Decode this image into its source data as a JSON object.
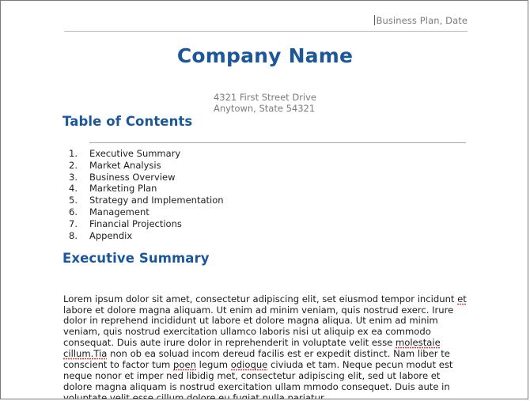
{
  "document": {
    "header": {
      "text": "Business Plan, Date",
      "caret_visible": true
    },
    "title": "Company Name",
    "address": {
      "line1": "4321 First Street Drive",
      "line2": "Anytown, State 54321"
    },
    "toc": {
      "heading": "Table of Contents",
      "items": [
        {
          "number": "1.",
          "label": "Executive Summary"
        },
        {
          "number": "2.",
          "label": "Market Analysis"
        },
        {
          "number": "3.",
          "label": "Business Overview"
        },
        {
          "number": "4.",
          "label": "Marketing Plan"
        },
        {
          "number": "5.",
          "label": "Strategy and Implementation"
        },
        {
          "number": "6.",
          "label": "Management"
        },
        {
          "number": "7.",
          "label": "Financial Projections"
        },
        {
          "number": "8.",
          "label": "Appendix"
        }
      ]
    },
    "executive_summary": {
      "heading": "Executive Summary",
      "segments": [
        {
          "text": "Lorem ipsum dolor sit amet, consectetur adipiscing elit, set eiusmod tempor incidunt ",
          "misspelled": false
        },
        {
          "text": "et",
          "misspelled": true
        },
        {
          "text": " labore et dolore magna aliquam. Ut enim ad minim veniam, quis nostrud exerc. Irure dolor in reprehend incididunt ut labore et dolore magna aliqua. Ut enim ad minim veniam, quis nostrud exercitation ullamco laboris nisi ut aliquip ex ea commodo consequat. Duis aute irure dolor in reprehenderit in voluptate velit esse ",
          "misspelled": false
        },
        {
          "text": "molestaie",
          "misspelled": true
        },
        {
          "text": " ",
          "misspelled": false
        },
        {
          "text": "cillum.Tia",
          "misspelled": true
        },
        {
          "text": " non ob ea soluad incom dereud facilis est er expedit distinct. Nam liber te conscient to factor tum ",
          "misspelled": false
        },
        {
          "text": "poen",
          "misspelled": true
        },
        {
          "text": " legum ",
          "misspelled": false
        },
        {
          "text": "odioque",
          "misspelled": true
        },
        {
          "text": " civiuda et tam. Neque pecun modut est neque nonor et imper ned libidig met, consectetur adipiscing elit, sed ut labore et dolore magna aliquam is nostrud exercitation ullam mmodo consequet. Duis aute in voluptate velit esse cillum dolore eu fugiat nulla pariatur.",
          "misspelled": false
        }
      ]
    },
    "colors": {
      "heading_blue": "#1c5799",
      "body_text": "#1c1c1c",
      "muted_text": "#7b7b7b",
      "rule": "#b9b9b9",
      "spellcheck_underline": "#d93b3b"
    }
  }
}
